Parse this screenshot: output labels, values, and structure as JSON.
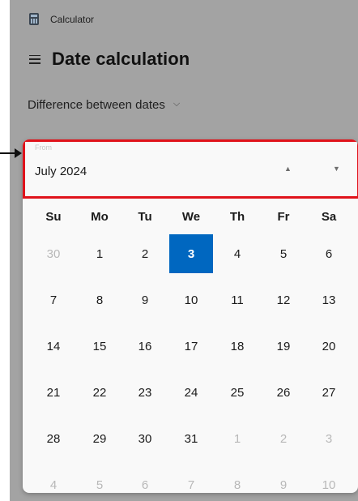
{
  "app": {
    "title": "Calculator",
    "icon": "calculator-icon"
  },
  "header": {
    "title": "Date calculation",
    "menu_icon": "hamburger-menu-icon"
  },
  "mode": {
    "label": "Difference between dates",
    "icon": "chevron-down-icon"
  },
  "calendar": {
    "header_hint": "From",
    "month_label": "July 2024",
    "nav_up_icon": "▲",
    "nav_down_icon": "▼",
    "weekdays": [
      "Su",
      "Mo",
      "Tu",
      "We",
      "Th",
      "Fr",
      "Sa"
    ],
    "weeks": [
      [
        "30",
        "1",
        "2",
        "3",
        "4",
        "5",
        "6"
      ],
      [
        "7",
        "8",
        "9",
        "10",
        "11",
        "12",
        "13"
      ],
      [
        "14",
        "15",
        "16",
        "17",
        "18",
        "19",
        "20"
      ],
      [
        "21",
        "22",
        "23",
        "24",
        "25",
        "26",
        "27"
      ],
      [
        "28",
        "29",
        "30",
        "31",
        "1",
        "2",
        "3"
      ],
      [
        "4",
        "5",
        "6",
        "7",
        "8",
        "9",
        "10"
      ]
    ],
    "other_month": [
      [
        true,
        false,
        false,
        false,
        false,
        false,
        false
      ],
      [
        false,
        false,
        false,
        false,
        false,
        false,
        false
      ],
      [
        false,
        false,
        false,
        false,
        false,
        false,
        false
      ],
      [
        false,
        false,
        false,
        false,
        false,
        false,
        false
      ],
      [
        false,
        false,
        false,
        false,
        true,
        true,
        true
      ],
      [
        true,
        true,
        true,
        true,
        true,
        true,
        true
      ]
    ],
    "selected_day": "3",
    "accent_color": "#0067c0",
    "highlight_color": "#e0131b"
  }
}
